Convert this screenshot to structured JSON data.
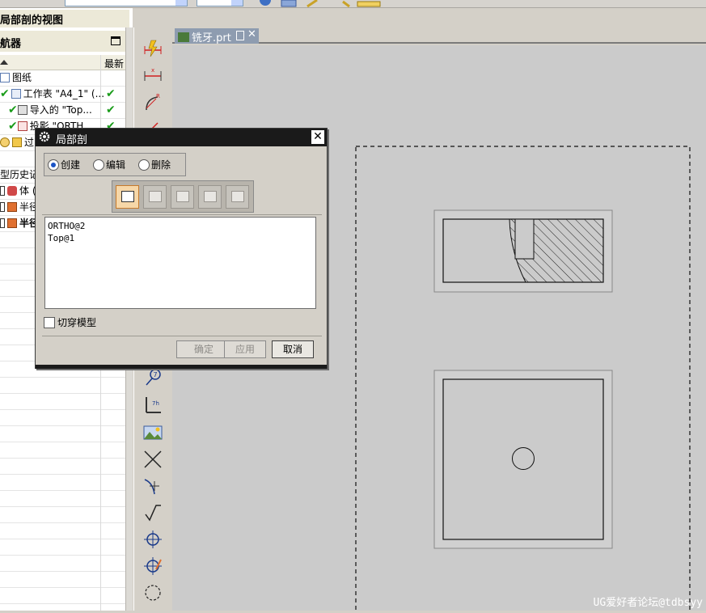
{
  "top_toolbar": {
    "combo1_value": "",
    "combo2_value": ""
  },
  "left_panel": {
    "title_fragment": "局部剖的视图",
    "navigator_title": "航器",
    "column_latest": "最新",
    "rows": [
      {
        "label": "图纸",
        "check": ""
      },
      {
        "label": "工作表 \"A4_1\" (...",
        "check": "✔"
      },
      {
        "label": "导入的 \"Top...",
        "check": "✔"
      },
      {
        "label": "投影 \"ORTH...",
        "check": "✔"
      },
      {
        "label": "过时",
        "check": ""
      },
      {
        "label": "",
        "check": ""
      },
      {
        "label": "型历史记",
        "check": ""
      },
      {
        "label": "体 (",
        "check": ""
      },
      {
        "label": "半径",
        "check": ""
      },
      {
        "label": "半径",
        "check": ""
      }
    ]
  },
  "graphics": {
    "tab_label": "铣牙.prt",
    "watermark": "UG爱好者论坛@tdbsyy"
  },
  "dialog": {
    "title": "局部剖",
    "radios": {
      "create": "创建",
      "edit": "编辑",
      "delete": "删除",
      "selected": "create"
    },
    "list_items": [
      "ORTHO@2",
      "Top@1"
    ],
    "checkbox_label": "切穿模型",
    "checkbox_checked": false,
    "buttons": {
      "ok": "确定",
      "apply": "应用",
      "cancel": "取消"
    }
  },
  "colors": {
    "canvas": "#cbcbcb",
    "dialog_title_bar": "#1a1a1a",
    "active_tool": "#f6d7a8",
    "check_green": "#1a9c1a"
  }
}
